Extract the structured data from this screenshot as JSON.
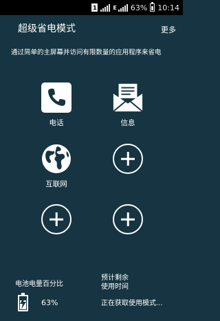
{
  "status_bar": {
    "sim_badge": "1",
    "network_type": "E",
    "battery_percent_text": "63%",
    "time": "10:14"
  },
  "header": {
    "title": "超级省电模式",
    "more_label": "更多"
  },
  "description": "通过简单的主屏幕并访问有限数量的应用程序来省电",
  "apps": [
    {
      "label": "电话",
      "icon": "phone-icon"
    },
    {
      "label": "信息",
      "icon": "message-envelope-icon"
    },
    {
      "label": "互联网",
      "icon": "globe-icon"
    },
    {
      "label": "",
      "icon": "add-icon"
    },
    {
      "label": "",
      "icon": "add-icon"
    },
    {
      "label": "",
      "icon": "add-icon"
    }
  ],
  "battery": {
    "label": "电池电量百分比",
    "value_text": "63%",
    "level": 0.63
  },
  "remaining": {
    "label_line1": "预计剩余",
    "label_line2": "使用时间",
    "status": "正在获取使用模式..."
  },
  "colors": {
    "background": "#163441",
    "status_bar": "#000000",
    "foreground": "#ffffff"
  }
}
